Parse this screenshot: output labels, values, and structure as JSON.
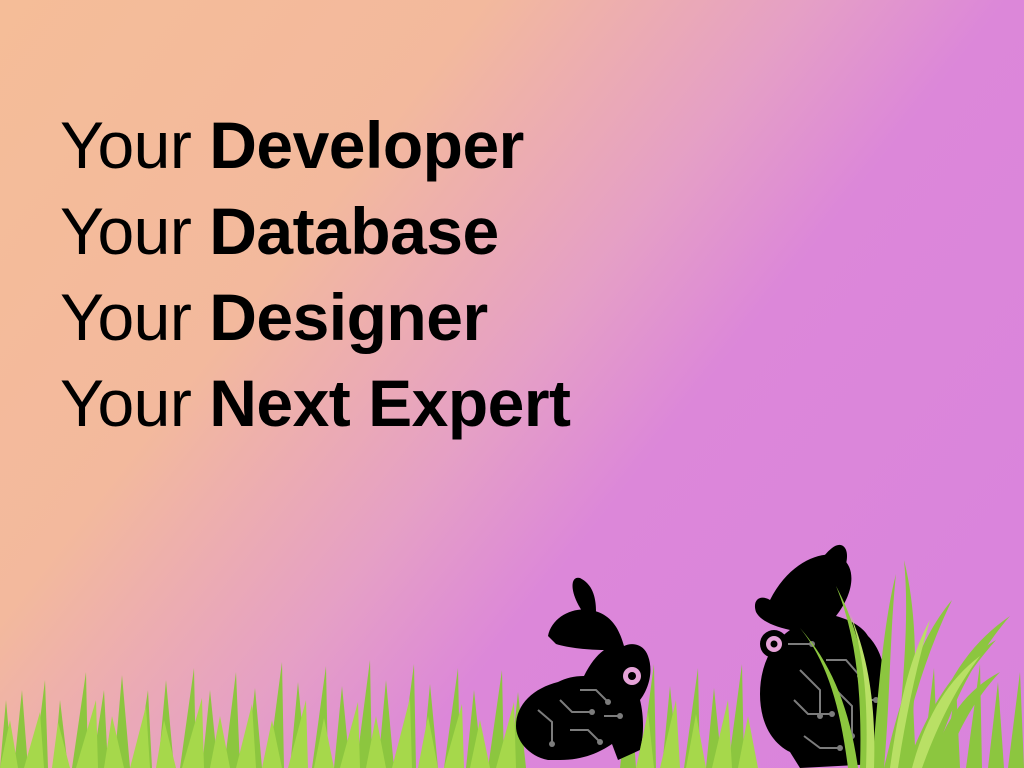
{
  "slide": {
    "lines": [
      {
        "prefix": "Your",
        "keyword": "Developer"
      },
      {
        "prefix": "Your",
        "keyword": "Database"
      },
      {
        "prefix": "Your",
        "keyword": "Designer"
      },
      {
        "prefix": "Your",
        "keyword": "Next Expert"
      }
    ]
  },
  "colors": {
    "background_start": "#f5bd98",
    "background_end": "#d983dd",
    "text": "#000000",
    "grass_dark": "#6fb12a",
    "grass_light": "#a6d84b",
    "rabbit": "#000000",
    "circuit": "#7c7c7c"
  },
  "illustration": {
    "icons": [
      "small-rabbit-icon",
      "large-rabbit-icon",
      "grass"
    ]
  }
}
